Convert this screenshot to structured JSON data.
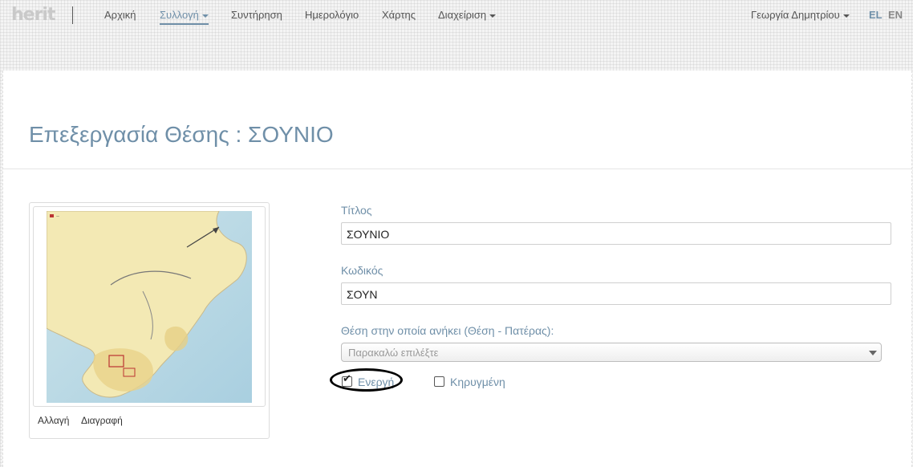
{
  "nav": {
    "logo": "herit",
    "items": [
      {
        "label": "Αρχική"
      },
      {
        "label": "Συλλογή"
      },
      {
        "label": "Συντήρηση"
      },
      {
        "label": "Ημερολόγιο"
      },
      {
        "label": "Χάρτης"
      },
      {
        "label": "Διαχείριση"
      }
    ],
    "user": "Γεωργία Δημητρίου",
    "lang_el": "EL",
    "lang_en": "EN"
  },
  "page": {
    "title": "Επεξεργασία Θέσης : ΣΟΥΝΙΟ"
  },
  "image_card": {
    "change_label": "Αλλαγή",
    "delete_label": "Διαγραφή"
  },
  "form": {
    "title_label": "Τίτλος",
    "title_value": "ΣΟΥΝΙΟ",
    "code_label": "Κωδικός",
    "code_value": "ΣΟΥΝ",
    "parent_label": "Θέση στην οποία ανήκει (Θέση - Πατέρας):",
    "parent_placeholder": "Παρακαλώ επιλέξτε",
    "active_label": "Ενεργή",
    "active_checked": true,
    "declared_label": "Κηρυγμένη",
    "declared_checked": false
  },
  "colors": {
    "accent": "#6f8fa8",
    "annotation": "#000000"
  }
}
